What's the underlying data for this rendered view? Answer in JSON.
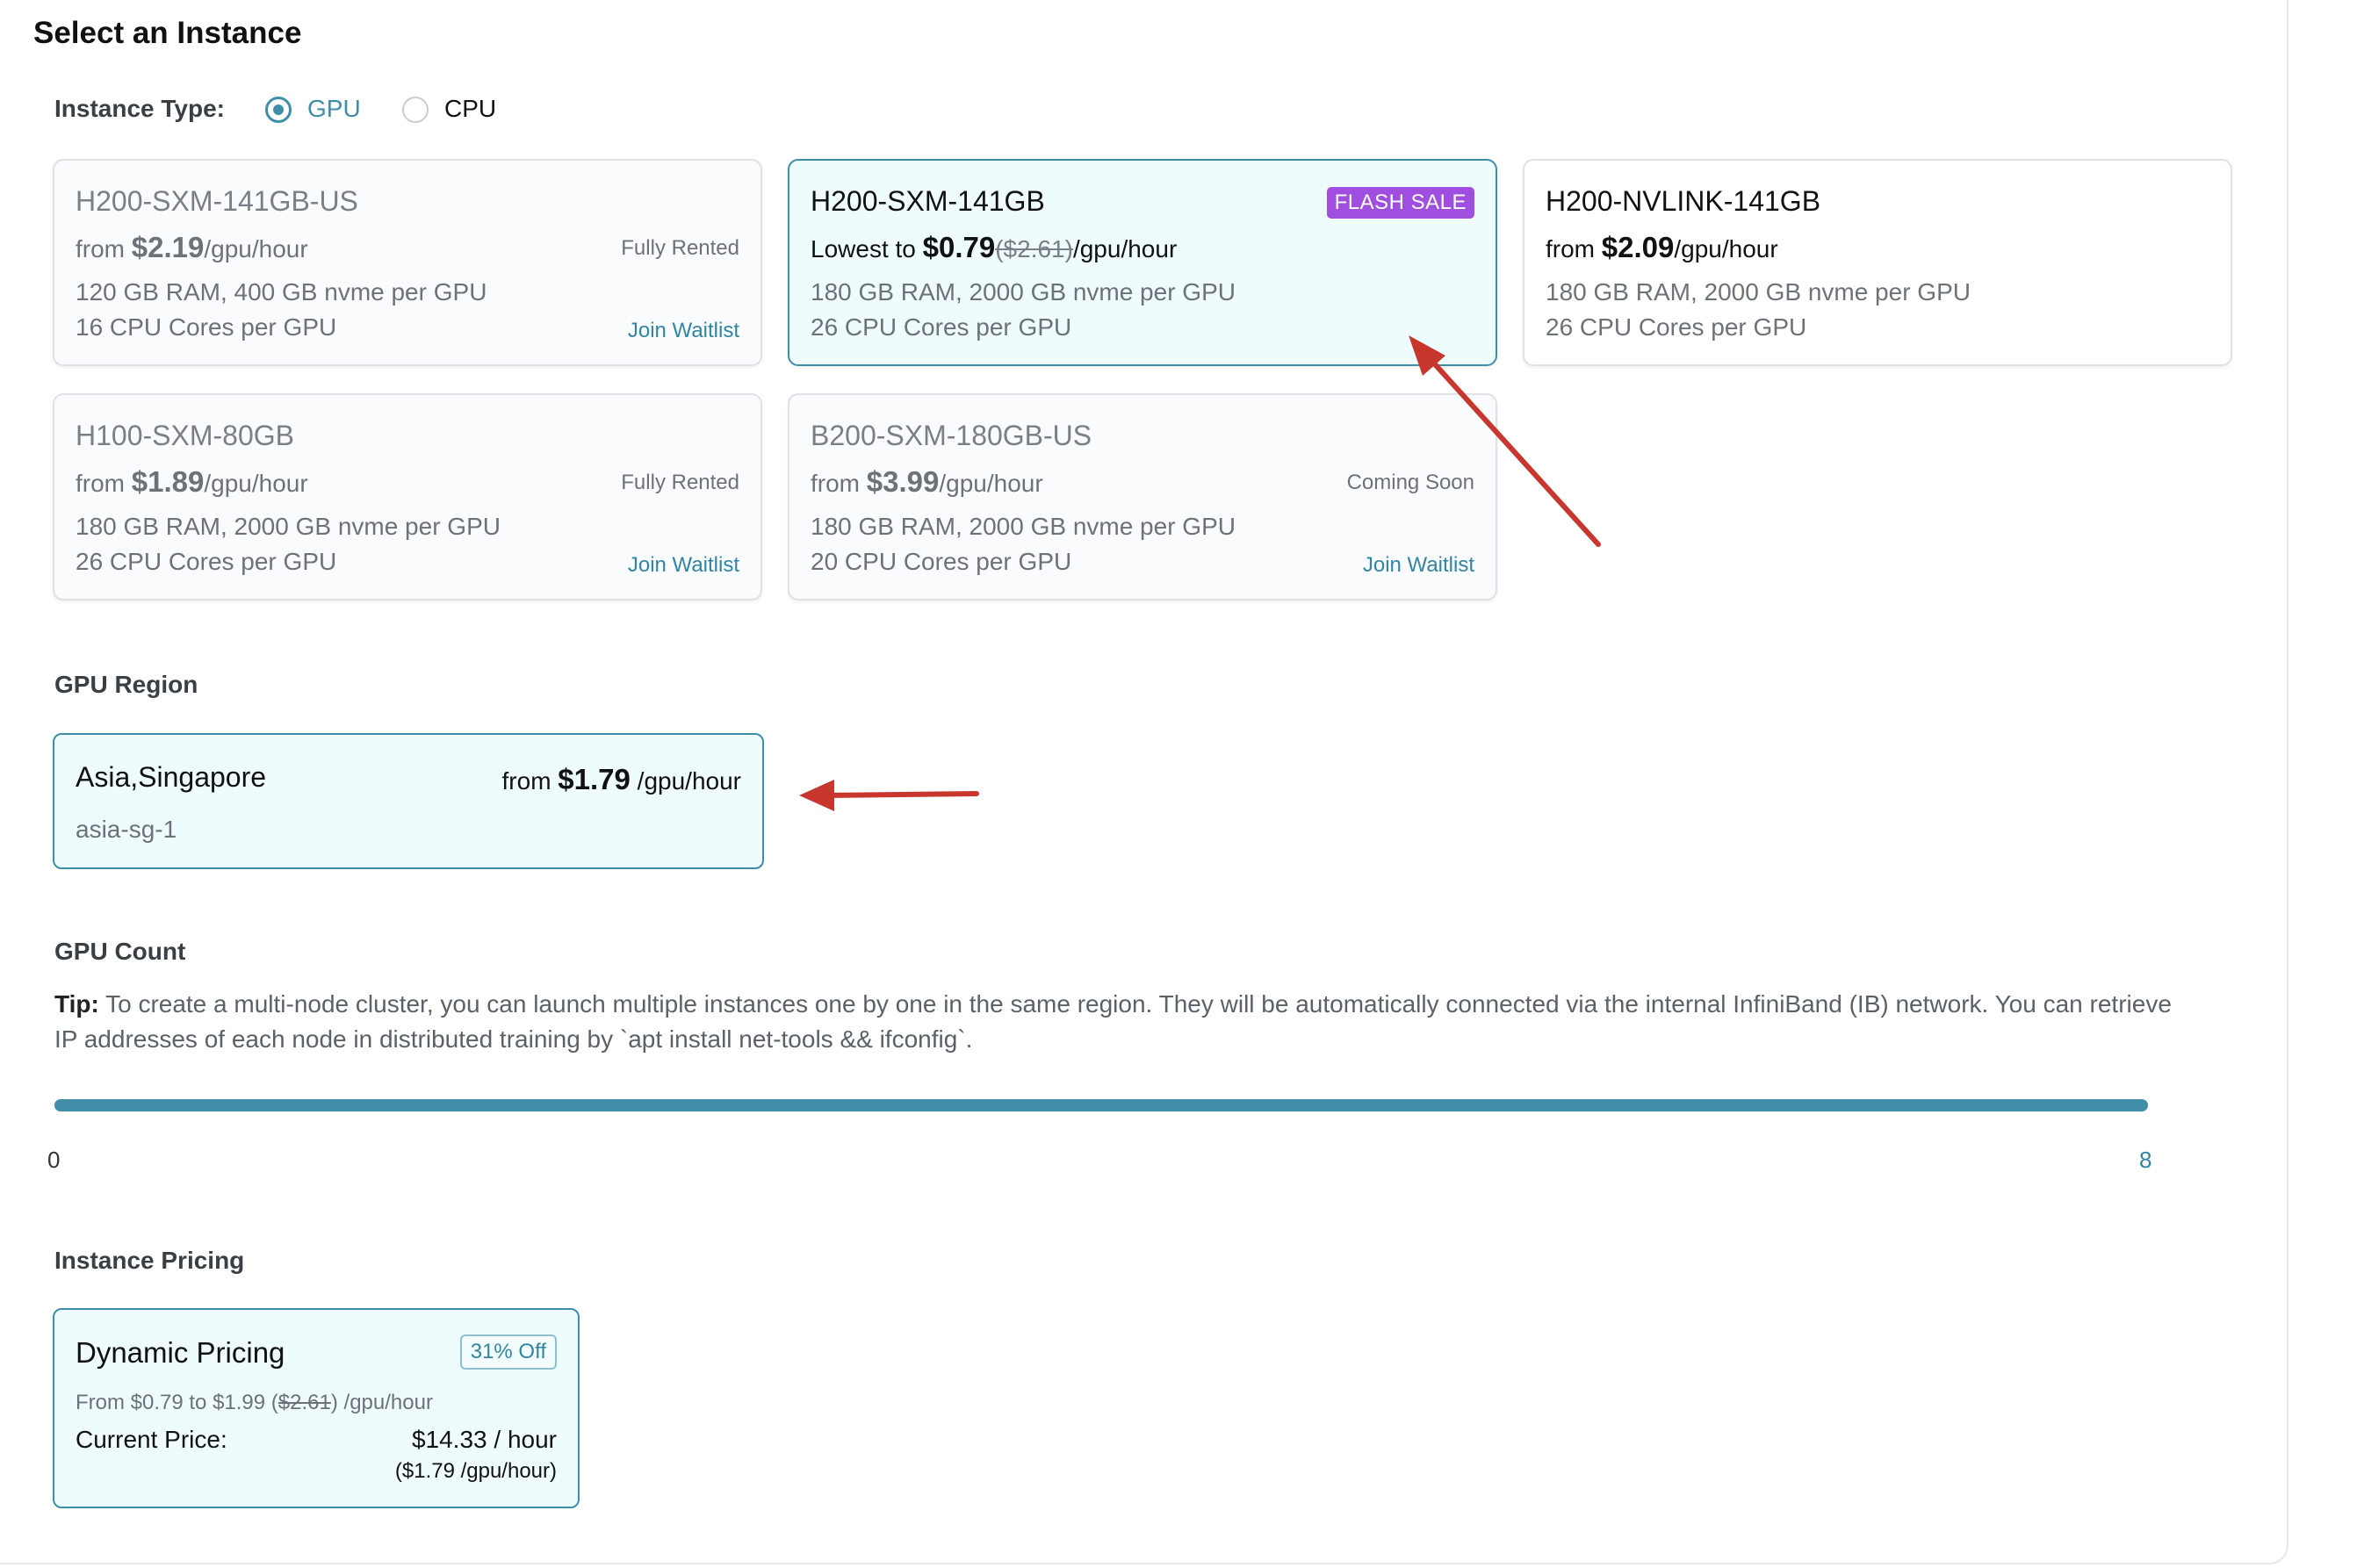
{
  "page": {
    "title": "Select an Instance",
    "instance_type_label": "Instance Type:",
    "instance_types": [
      {
        "label": "GPU",
        "selected": true
      },
      {
        "label": "CPU",
        "selected": false
      }
    ]
  },
  "instances": [
    {
      "name": "H200-SXM-141GB-US",
      "price_prefix": "from",
      "price": "$2.19",
      "price_suffix": "/gpu/hour",
      "status": "Fully Rented",
      "ram": "120 GB RAM, 400 GB nvme per GPU",
      "cpu": "16 CPU Cores per GPU",
      "action": "Join Waitlist"
    },
    {
      "name": "H200-SXM-141GB",
      "badge": "FLASH SALE",
      "price_prefix": "Lowest to",
      "price": "$0.79",
      "old_price": "($2.61)",
      "price_suffix": "/gpu/hour",
      "ram": "180 GB RAM, 2000 GB nvme per GPU",
      "cpu": "26 CPU Cores per GPU",
      "selected": true
    },
    {
      "name": "H200-NVLINK-141GB",
      "price_prefix": "from",
      "price": "$2.09",
      "price_suffix": "/gpu/hour",
      "ram": "180 GB RAM, 2000 GB nvme per GPU",
      "cpu": "26 CPU Cores per GPU"
    },
    {
      "name": "H100-SXM-80GB",
      "price_prefix": "from",
      "price": "$1.89",
      "price_suffix": "/gpu/hour",
      "status": "Fully Rented",
      "ram": "180 GB RAM, 2000 GB nvme per GPU",
      "cpu": "26 CPU Cores per GPU",
      "action": "Join Waitlist"
    },
    {
      "name": "B200-SXM-180GB-US",
      "price_prefix": "from",
      "price": "$3.99",
      "price_suffix": "/gpu/hour",
      "status": "Coming Soon",
      "ram": "180 GB RAM, 2000 GB nvme per GPU",
      "cpu": "20 CPU Cores per GPU",
      "action": "Join Waitlist"
    }
  ],
  "region": {
    "heading": "GPU Region",
    "name": "Asia,Singapore",
    "code": "asia-sg-1",
    "price_prefix": "from",
    "price": "$1.79",
    "price_suffix": "/gpu/hour"
  },
  "gpu_count": {
    "heading": "GPU Count",
    "tip_label": "Tip:",
    "tip_text": " To create a multi-node cluster, you can launch multiple instances one by one in the same region. They will be automatically connected via the internal InfiniBand (IB) network. You can retrieve IP addresses of each node in distributed training by `apt install net-tools && ifconfig`.",
    "min_label": "0",
    "max_label": "8",
    "value": 8,
    "accent": "#418ea9"
  },
  "pricing": {
    "heading": "Instance Pricing",
    "name": "Dynamic Pricing",
    "badge": "31% Off",
    "range_prefix": "From $0.79 to $1.99 (",
    "range_old": "$2.61",
    "range_suffix": ") /gpu/hour",
    "current_label": "Current Price:",
    "current_value": "$14.33 / hour",
    "current_per": "($1.79 /gpu/hour)"
  },
  "colors": {
    "accent": "#3d8fa9",
    "flash_sale": "#a04ee0",
    "annotation_arrow": "#c8372d"
  }
}
